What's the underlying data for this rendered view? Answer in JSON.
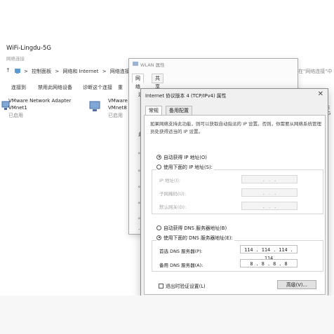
{
  "network_window": {
    "wifi_name": "WiFi-Lingdu-5G",
    "subtitle": "网络连接",
    "breadcrumbs": [
      "控制面板",
      "网络和 Internet",
      "网络连接"
    ],
    "breadcrumb_sep": ">",
    "search_placeholder": "在\"网络连接\"中",
    "commands": [
      "连接到",
      "禁用此网络设备",
      "诊断这个连接",
      "重"
    ],
    "adapters": [
      {
        "name": "VMware Network Adapter",
        "sub": "VMnet1",
        "status": "已启用"
      },
      {
        "name": "VMware",
        "sub": "VMnet8",
        "status": "已启用"
      }
    ],
    "right_truncated": "E\nG"
  },
  "wlan_dialog": {
    "title": "WLAN 属性",
    "tabs": [
      "网络",
      "共享"
    ],
    "fragments": [
      "连",
      "此",
      "。",
      "。",
      "。",
      "。",
      "。",
      "…"
    ]
  },
  "ipv4_dialog": {
    "title": "Internet 协议版本 4 (TCP/IPv4) 属性",
    "close_label": "✕",
    "tabs": [
      "常规",
      "备用配置"
    ],
    "description": "如果网络支持此功能，则可以获取自动指派的 IP 设置。否则，你需要从网络系统管理员处获得适当的 IP 设置。",
    "ip_auto": "自动获得 IP 地址(O)",
    "ip_manual": "使用下面的 IP 地址(S):",
    "ip_fields": [
      {
        "label": "IP 地址(I):",
        "value": ". . ."
      },
      {
        "label": "子网掩码(U):",
        "value": ". . ."
      },
      {
        "label": "默认网关(D):",
        "value": ". . ."
      }
    ],
    "dns_auto": "自动获得 DNS 服务器地址(B)",
    "dns_manual": "使用下面的 DNS 服务器地址(E):",
    "dns_fields": [
      {
        "label": "首选 DNS 服务器(P):",
        "value": "114 . 114 . 114 . 114"
      },
      {
        "label": "备用 DNS 服务器(A):",
        "value": "8 .  8 .  8 .  8"
      }
    ],
    "validate_label": "退出时验证设置(L)",
    "advanced_label": "高级(V)...",
    "selected": {
      "ip": "auto",
      "dns": "manual"
    },
    "validate_checked": false
  }
}
